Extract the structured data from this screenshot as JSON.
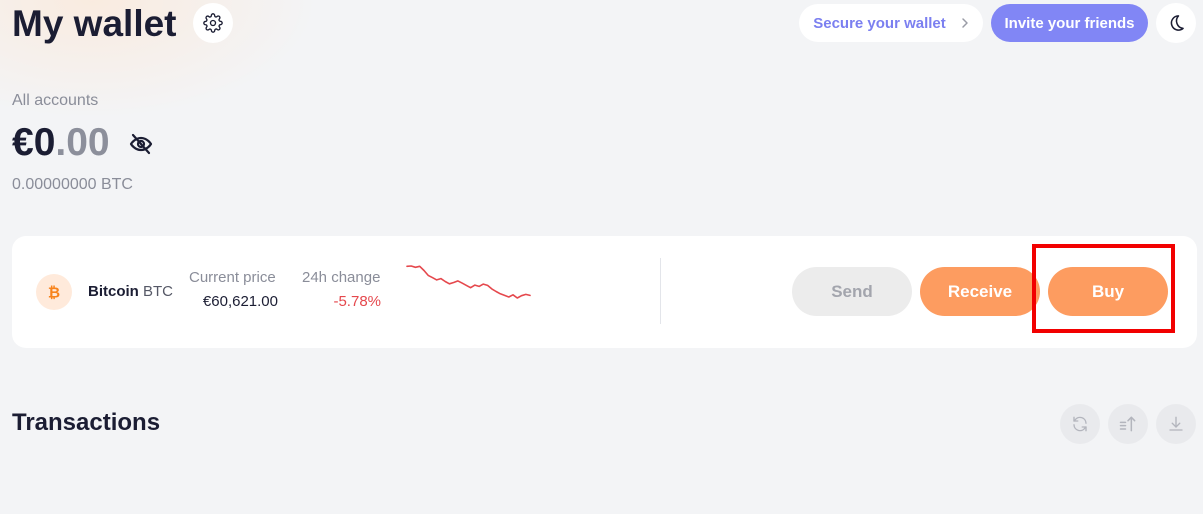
{
  "header": {
    "title": "My wallet",
    "secure_label": "Secure your wallet",
    "invite_label": "Invite your friends"
  },
  "summary": {
    "accounts_label": "All accounts",
    "balance_whole": "€0",
    "balance_decimal": ".00",
    "btc_total": "0.00000000 BTC"
  },
  "asset": {
    "name": "Bitcoin",
    "ticker": "BTC",
    "price_label": "Current price",
    "price_value": "€60,621.00",
    "change_label": "24h change",
    "change_value": "-5.78%",
    "sparkline": [
      100,
      101,
      97,
      100,
      87,
      72,
      65,
      58,
      62,
      53,
      46,
      50,
      55,
      48,
      41,
      34,
      42,
      38,
      45,
      41,
      30,
      22,
      15,
      10,
      5,
      12,
      2,
      9,
      13,
      10
    ],
    "actions": {
      "send": "Send",
      "receive": "Receive",
      "buy": "Buy"
    }
  },
  "transactions": {
    "title": "Transactions"
  },
  "icons": {
    "settings": "gear-icon",
    "theme": "moon-icon",
    "visibility": "eye-off-icon",
    "coin": "bitcoin-icon",
    "refresh": "refresh-icon",
    "sort": "sort-icon",
    "download": "download-icon",
    "chevron": "chevron-right-icon"
  },
  "colors": {
    "accent": "#8186f5",
    "orange": "#fd9c60",
    "negative": "#e5484d",
    "highlight": "#f20000"
  }
}
